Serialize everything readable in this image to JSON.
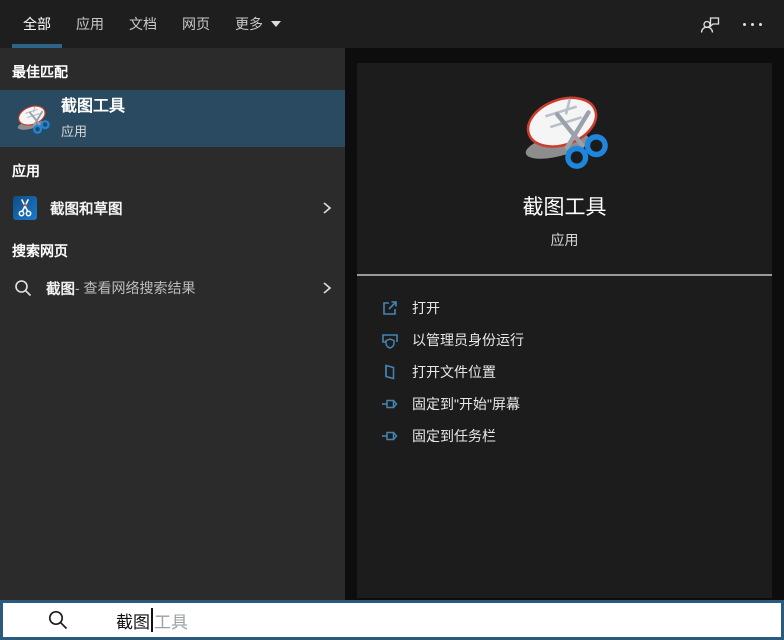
{
  "tabbar": {
    "tabs": [
      {
        "label": "全部",
        "active": true
      },
      {
        "label": "应用",
        "active": false
      },
      {
        "label": "文档",
        "active": false
      },
      {
        "label": "网页",
        "active": false
      },
      {
        "label": "更多",
        "active": false,
        "has_dropdown": true
      }
    ],
    "icons": [
      "feedback-icon",
      "more-options-ellipsis"
    ]
  },
  "left_panel": {
    "sections": [
      {
        "header": "最佳匹配",
        "item": {
          "title": "截图工具",
          "subtitle": "应用",
          "selected": true,
          "icon": "snipping-tool-icon"
        }
      },
      {
        "header": "应用",
        "item": {
          "title": "截图和草图",
          "icon": "snip-sketch-app-icon",
          "chevron": true
        }
      },
      {
        "header": "搜索网页",
        "item": {
          "title": "截图",
          "suffix": " - 查看网络搜索结果",
          "icon": "search-icon",
          "chevron": true
        }
      }
    ]
  },
  "preview_panel": {
    "app_title": "截图工具",
    "app_subtitle": "应用",
    "actions": [
      {
        "label": "打开",
        "icon": "open-icon"
      },
      {
        "label": "以管理员身份运行",
        "icon": "run-as-admin-icon"
      },
      {
        "label": "打开文件位置",
        "icon": "open-file-location-icon"
      },
      {
        "label": "固定到\"开始\"屏幕",
        "icon": "pin-to-start-icon"
      },
      {
        "label": "固定到任务栏",
        "icon": "pin-to-taskbar-icon"
      }
    ]
  },
  "search_bar": {
    "typed_text": "截图",
    "suggestion_text": "工具",
    "icon": "search-icon"
  },
  "colors": {
    "accent_underline": "#2e648c",
    "selected_row": "#2a4a61",
    "left_panel_bg": "#2b2b2b",
    "preview_bg": "#1c1c1c",
    "tabbar_bg": "#1e1e1e",
    "action_icon_blue": "#4484b4",
    "search_border": "#2b5a7d"
  }
}
